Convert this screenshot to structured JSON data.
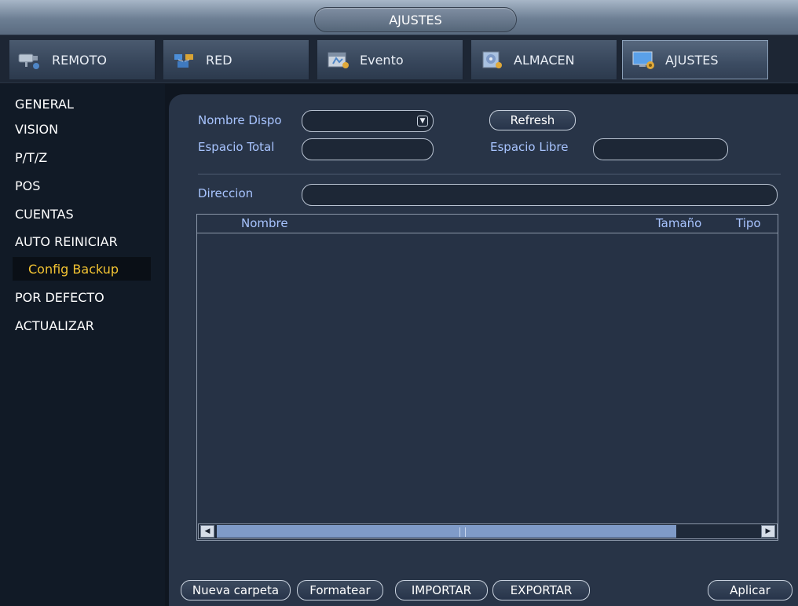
{
  "window": {
    "title": "AJUSTES"
  },
  "tabs": [
    {
      "label": "REMOTO",
      "icon": "camera-icon"
    },
    {
      "label": "RED",
      "icon": "network-icon"
    },
    {
      "label": "Evento",
      "icon": "event-icon"
    },
    {
      "label": "ALMACEN",
      "icon": "storage-icon"
    },
    {
      "label": "AJUSTES",
      "icon": "settings-monitor-icon",
      "active": true
    }
  ],
  "sidebar": {
    "items": [
      {
        "label": "GENERAL"
      },
      {
        "label": "VISION"
      },
      {
        "label": "P/T/Z"
      },
      {
        "label": "POS"
      },
      {
        "label": "CUENTAS"
      },
      {
        "label": "AUTO REINICIAR"
      },
      {
        "label": "Config Backup",
        "active": true
      },
      {
        "label": "POR DEFECTO"
      },
      {
        "label": "ACTUALIZAR"
      }
    ]
  },
  "form": {
    "device_name_label": "Nombre Dispo",
    "device_name_value": "",
    "refresh_label": "Refresh",
    "total_space_label": "Espacio Total",
    "total_space_value": "",
    "free_space_label": "Espacio Libre",
    "free_space_value": "",
    "address_label": "Direccion",
    "address_value": ""
  },
  "file_table": {
    "columns": [
      "Nombre",
      "Tamaño",
      "Tipo"
    ],
    "rows": []
  },
  "footer": {
    "new_folder_label": "Nueva carpeta",
    "format_label": "Formatear",
    "import_label": "IMPORTAR",
    "export_label": "EXPORTAR",
    "apply_label": "Aplicar"
  },
  "colors": {
    "accent_label": "#a8c4ff",
    "active_sidebar_text": "#f1c232",
    "panel_bg": "#283447"
  }
}
